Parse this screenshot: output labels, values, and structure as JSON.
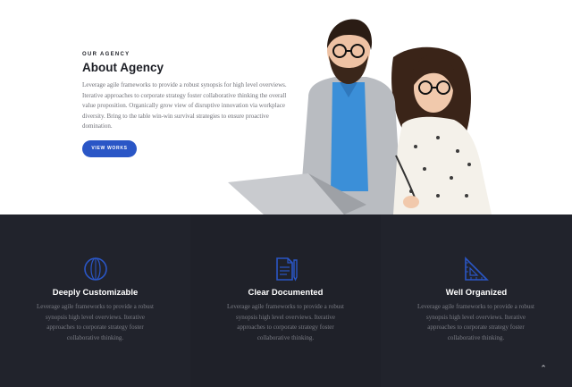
{
  "about": {
    "eyebrow": "OUR AGENCY",
    "title": "About Agency",
    "body": "Leverage agile frameworks to provide a robust synopsis for high level overviews. Iterative approaches to corporate strategy foster collaborative thinking the overall value proposition. Organically grow view of disruptive innovation via workplace diversity. Bring to the table win-win survival strategies to ensure proactive domination.",
    "button": "VIEW WORKS"
  },
  "features": [
    {
      "icon": "sphere-icon",
      "title": "Deeply Customizable",
      "text": "Leverage agile frameworks to provide a robust synopsis high level overviews. Iterative approaches to corporate strategy foster collaborative thinking."
    },
    {
      "icon": "document-pencil-icon",
      "title": "Clear Documented",
      "text": "Leverage agile frameworks to provide a robust synopsis high level overviews. Iterative approaches to corporate strategy foster collaborative thinking."
    },
    {
      "icon": "set-square-icon",
      "title": "Well Organized",
      "text": "Leverage agile frameworks to provide a robust synopsis high level overviews. Iterative approaches to corporate strategy foster collaborative thinking."
    }
  ],
  "back_to_top": "⌃",
  "colors": {
    "accent": "#2a56c6",
    "dark_bg": "#1f2129",
    "heading": "#1c1e25",
    "muted": "#6f7077"
  }
}
